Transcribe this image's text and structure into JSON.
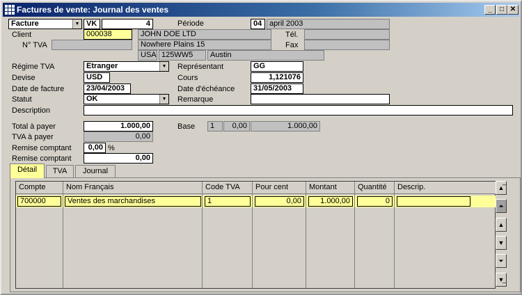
{
  "window": {
    "title": "Factures de vente: Journal des ventes",
    "buttons": {
      "minimize": "_",
      "maximize": "□",
      "close": "✕"
    }
  },
  "header": {
    "doc_type": "Facture",
    "journal": "VK",
    "number": "4",
    "periode_label": "Période",
    "periode_num": "04",
    "periode_text": "april 2003"
  },
  "client": {
    "label": "Client",
    "code": "000038",
    "name": "JOHN DOE LTD",
    "tel_label": "Tél.",
    "tel": "",
    "tva_label": "N° TVA",
    "tva": "",
    "street": "Nowhere Plains 15",
    "fax_label": "Fax",
    "fax": "",
    "country": "USA",
    "zip": "125WW5",
    "city": "Austin"
  },
  "details": {
    "regime_label": "Régime TVA",
    "regime": "Etranger",
    "rep_label": "Représentant",
    "rep": "GG",
    "devise_label": "Devise",
    "devise": "USD",
    "cours_label": "Cours",
    "cours": "1,121076",
    "date_label": "Date de facture",
    "date": "23/04/2003",
    "echeance_label": "Date d'échéance",
    "echeance": "31/05/2003",
    "statut_label": "Statut",
    "statut": "OK",
    "remarque_label": "Remarque",
    "remarque": "",
    "description_label": "Description",
    "description": ""
  },
  "totals": {
    "total_label": "Total à payer",
    "total": "1.000,00",
    "base_label": "Base",
    "base_code": "1",
    "base_tva": "0,00",
    "base_amount": "1.000,00",
    "tva_label": "TVA à payer",
    "tva": "0,00",
    "remise_pct_label": "Remise comptant",
    "remise_pct": "0,00",
    "pct_sign": "%",
    "remise_label": "Remise comptant",
    "remise": "0,00"
  },
  "tabs": [
    {
      "label": "Détail"
    },
    {
      "label": "TVA"
    },
    {
      "label": "Journal"
    }
  ],
  "grid": {
    "headers": [
      "Compte",
      "Nom Français",
      "Code TVA",
      "Pour cent",
      "Montant",
      "Quantité",
      "Descrip."
    ],
    "row": {
      "compte": "700000",
      "nom": "Ventes des marchandises",
      "code_tva": "1",
      "pour_cent": "0,00",
      "montant": "1.000,00",
      "quantite": "0",
      "descrip": ""
    }
  },
  "nav": {
    "first": "first-record-icon",
    "page_up": "page-up-icon",
    "up": "up-icon",
    "down": "down-icon",
    "page_down": "page-down-icon",
    "last": "last-record-icon"
  }
}
